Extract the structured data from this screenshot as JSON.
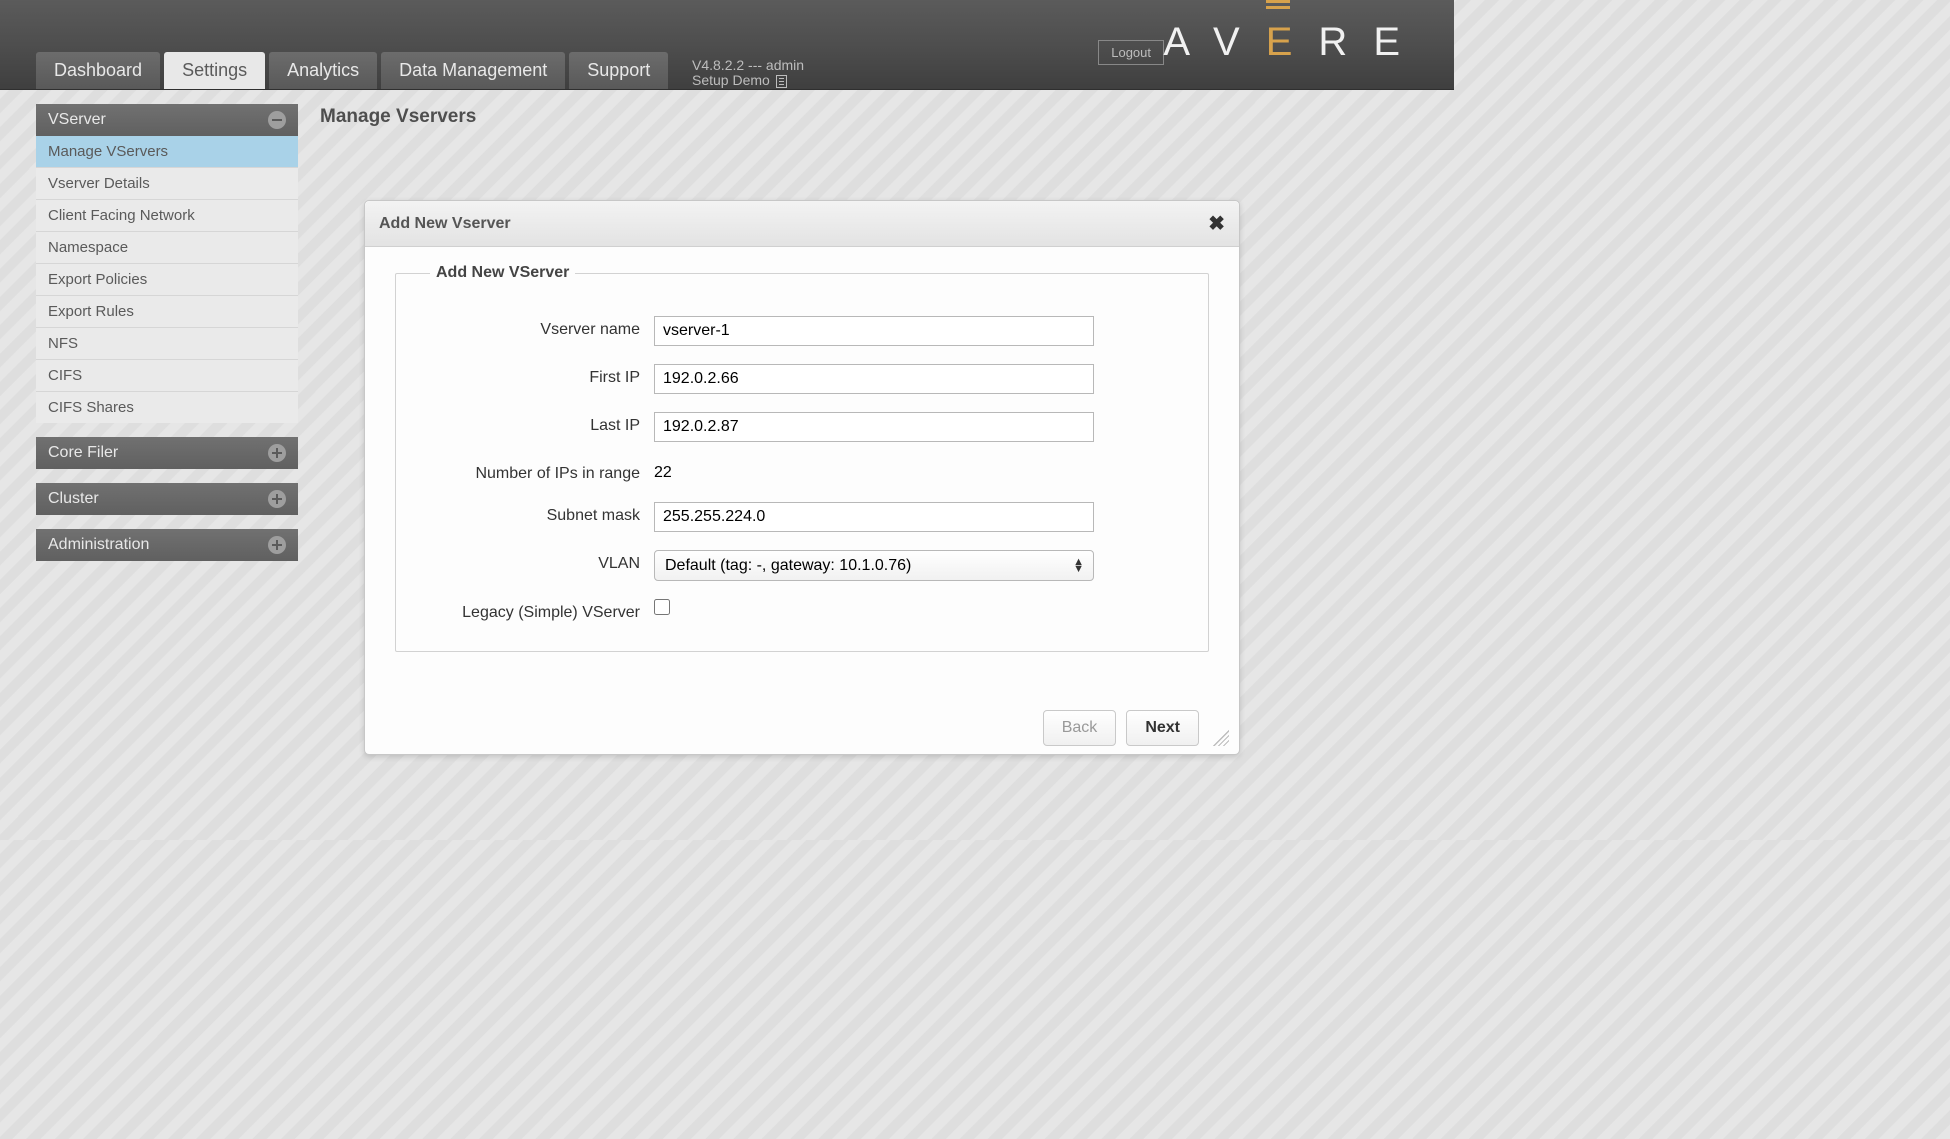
{
  "header": {
    "logout_label": "Logout",
    "logo_letters": [
      "A",
      "V",
      "E",
      "R",
      "E"
    ],
    "version_line": "V4.8.2.2 --- admin",
    "setup_line": "Setup Demo"
  },
  "tabs": [
    {
      "id": "dashboard",
      "label": "Dashboard",
      "active": false
    },
    {
      "id": "settings",
      "label": "Settings",
      "active": true
    },
    {
      "id": "analytics",
      "label": "Analytics",
      "active": false
    },
    {
      "id": "dataman",
      "label": "Data Management",
      "active": false
    },
    {
      "id": "support",
      "label": "Support",
      "active": false
    }
  ],
  "sidebar": {
    "sections": [
      {
        "id": "vserver",
        "label": "VServer",
        "expanded": true,
        "items": [
          {
            "id": "manage-vservers",
            "label": "Manage VServers",
            "active": true
          },
          {
            "id": "vserver-details",
            "label": "Vserver Details",
            "active": false
          },
          {
            "id": "client-facing-network",
            "label": "Client Facing Network",
            "active": false
          },
          {
            "id": "namespace",
            "label": "Namespace",
            "active": false
          },
          {
            "id": "export-policies",
            "label": "Export Policies",
            "active": false
          },
          {
            "id": "export-rules",
            "label": "Export Rules",
            "active": false
          },
          {
            "id": "nfs",
            "label": "NFS",
            "active": false
          },
          {
            "id": "cifs",
            "label": "CIFS",
            "active": false
          },
          {
            "id": "cifs-shares",
            "label": "CIFS Shares",
            "active": false
          }
        ]
      },
      {
        "id": "core-filer",
        "label": "Core Filer",
        "expanded": false,
        "items": []
      },
      {
        "id": "cluster",
        "label": "Cluster",
        "expanded": false,
        "items": []
      },
      {
        "id": "administration",
        "label": "Administration",
        "expanded": false,
        "items": []
      }
    ]
  },
  "page": {
    "title": "Manage Vservers"
  },
  "dialog": {
    "title": "Add New Vserver",
    "fieldset_legend": "Add New VServer",
    "labels": {
      "vserver_name": "Vserver name",
      "first_ip": "First IP",
      "last_ip": "Last IP",
      "num_ips": "Number of IPs in range",
      "subnet_mask": "Subnet mask",
      "vlan": "VLAN",
      "legacy": "Legacy (Simple) VServer"
    },
    "values": {
      "vserver_name": "vserver-1",
      "first_ip": "192.0.2.66",
      "last_ip": "192.0.2.87",
      "num_ips": "22",
      "subnet_mask": "255.255.224.0",
      "vlan_selected": "Default (tag: -, gateway: 10.1.0.76)",
      "legacy_checked": false
    },
    "buttons": {
      "back": "Back",
      "next": "Next"
    }
  }
}
